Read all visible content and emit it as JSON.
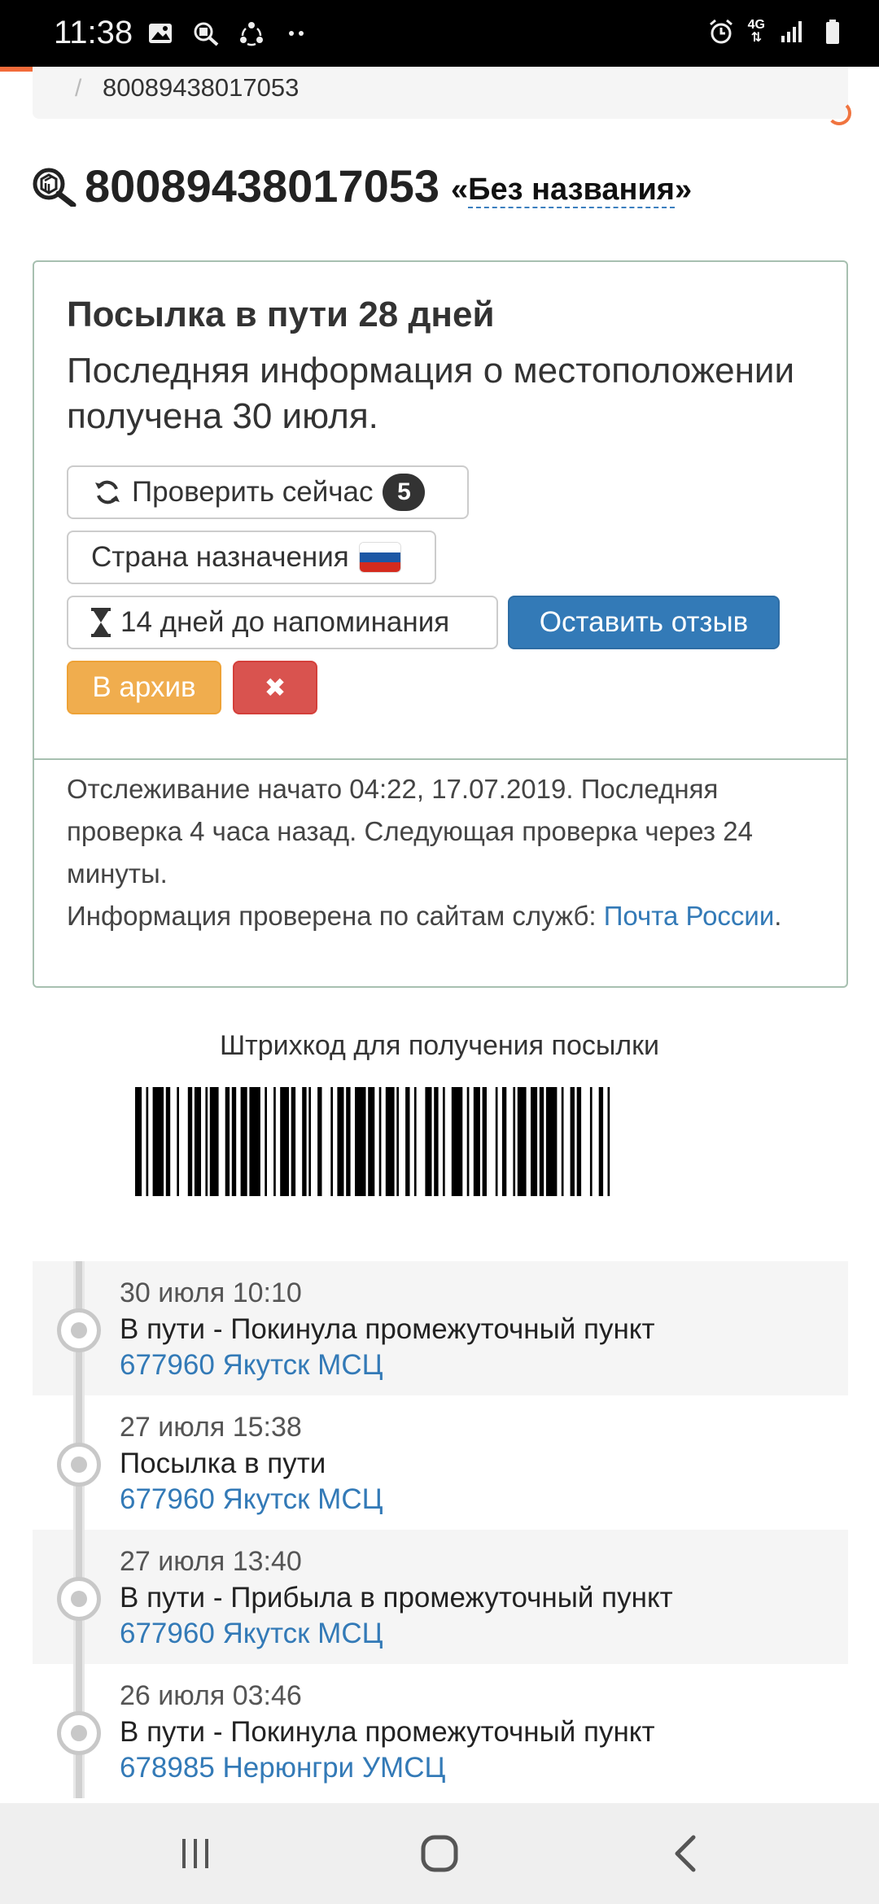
{
  "status_bar": {
    "time": "11:38",
    "left_icons": [
      "image-icon",
      "track-app-icon",
      "sync-icon",
      "more-dots-icon"
    ],
    "right_icons": [
      "alarm-icon",
      "4g-lte-icon",
      "signal-icon",
      "battery-icon"
    ],
    "network_label": "4G"
  },
  "breadcrumb": {
    "separator": "/",
    "current": "80089438017053"
  },
  "heading": {
    "track_number": "80089438017053",
    "quote_open": "«",
    "name": "Без названия",
    "quote_close": "»"
  },
  "status_panel": {
    "title": "Посылка в пути 28 дней",
    "text": "Последняя информация о местоположении получена 30 июля.",
    "buttons": {
      "check_now": "Проверить сейчас",
      "check_count": "5",
      "destination_country": "Страна назначения",
      "reminder": "14 дней до напоминания",
      "review": "Оставить отзыв",
      "archive": "В архив",
      "delete": "✖"
    },
    "flag_colors": [
      "#ffffff",
      "#1c57a5",
      "#d52b1e"
    ],
    "info": {
      "tracking_started": "Отслеживание начато 04:22, 17.07.2019. Последняя проверка 4 часа назад. Следующая проверка через 24 минуты.",
      "checked_prefix": "Информация проверена по сайтам служб: ",
      "service_link": "Почта России",
      "checked_suffix": "."
    }
  },
  "barcode": {
    "title": "Штрихкод для получения посылки"
  },
  "timeline": [
    {
      "date": "30 июля 10:10",
      "status": "В пути - Покинула промежуточный пункт",
      "place": "677960 Якутск МСЦ"
    },
    {
      "date": "27 июля 15:38",
      "status": "Посылка в пути",
      "place": "677960 Якутск МСЦ"
    },
    {
      "date": "27 июля 13:40",
      "status": "В пути - Прибыла в промежуточный пункт",
      "place": "677960 Якутск МСЦ"
    },
    {
      "date": "26 июля 03:46",
      "status": "В пути - Покинула промежуточный пункт",
      "place": "678985 Нерюнгри УМСЦ"
    }
  ],
  "nav_bar": {
    "buttons": [
      "recent-apps-icon",
      "home-icon",
      "back-icon"
    ]
  },
  "colors": {
    "accent_blue": "#337ab7",
    "archive_orange": "#f0ad4e",
    "delete_red": "#d9534f",
    "progress_orange": "#f26b3a"
  }
}
